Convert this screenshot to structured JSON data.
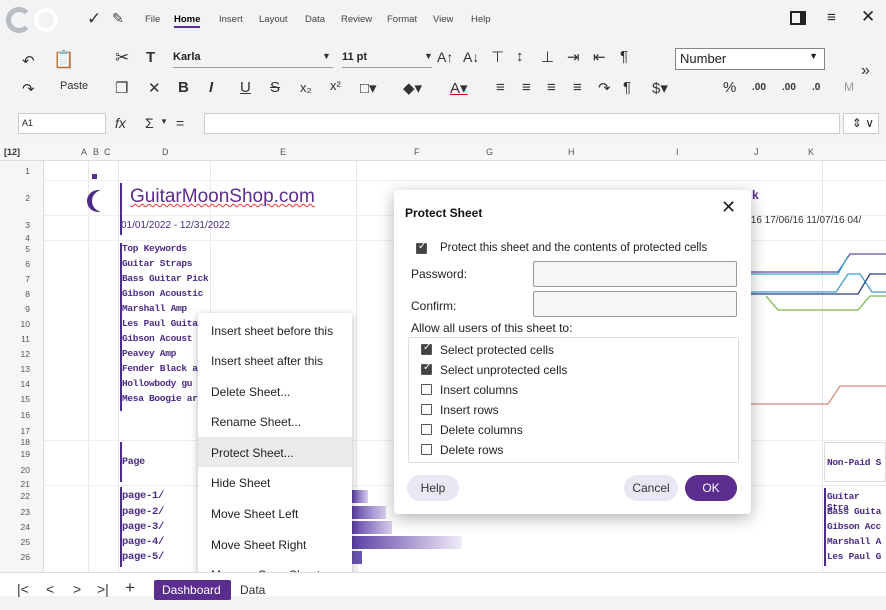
{
  "menubar": {
    "items": [
      "File",
      "Home",
      "Insert",
      "Layout",
      "Data",
      "Review",
      "Format",
      "View",
      "Help"
    ],
    "active": "Home"
  },
  "toolbar": {
    "paste_label": "Paste",
    "font_name": "Karla",
    "font_size": "11 pt",
    "number_format": "Number",
    "more": "»"
  },
  "formula": {
    "cell_ref": "A1",
    "fx": "fx",
    "sum": "Σ",
    "eq": "="
  },
  "columns": [
    "A",
    "B",
    "C",
    "D",
    "E",
    "F",
    "G",
    "H",
    "I",
    "J",
    "K"
  ],
  "rows": [
    "1",
    "2",
    "3",
    "4",
    "5",
    "6",
    "7",
    "8",
    "9",
    "10",
    "11",
    "12",
    "13",
    "14",
    "15",
    "16",
    "17",
    "18",
    "19",
    "20",
    "21",
    "22",
    "23",
    "24",
    "25",
    "26"
  ],
  "sheet": {
    "title": "GuitarMoonShop.com",
    "date_range": "01/01/2022 - 12/31/2022",
    "keywords_header": "Top Keywords",
    "keywords": [
      "Guitar Straps",
      "Bass Guitar Pick",
      "Gibson Acoustic",
      "Marshall Amp",
      "Les Paul Guitar",
      "Gibson Acoust",
      "Peavey Amp",
      "Fender Black ar",
      "Hollowbody gu",
      "Mesa Boogie ar"
    ],
    "page_header": "Page",
    "pages": [
      "page-1/",
      "page-2/",
      "page-3/",
      "page-4/",
      "page-5/"
    ],
    "nonpaid_header": "Non-Paid S",
    "nonpaid": [
      "Guitar Stra",
      "Bass Guita",
      "Gibson Acc",
      "Marshall A",
      "Les Paul G"
    ],
    "chart_k": "k",
    "chart_dates": "/16 17/06/16 11/07/16 04/"
  },
  "context_menu": {
    "items": [
      "Insert sheet before this",
      "Insert sheet after this",
      "Delete Sheet...",
      "Rename Sheet...",
      "Protect Sheet...",
      "Hide Sheet",
      "Move Sheet Left",
      "Move Sheet Right",
      "Move or Copy Sheet..."
    ],
    "selected": "Protect Sheet..."
  },
  "dialog": {
    "title": "Protect Sheet",
    "protect_label": "Protect this sheet and the contents of protected cells",
    "password_label": "Password:",
    "confirm_label": "Confirm:",
    "allow_label": "Allow all users of this sheet to:",
    "permissions": [
      {
        "label": "Select protected cells",
        "checked": true
      },
      {
        "label": "Select unprotected cells",
        "checked": true
      },
      {
        "label": "Insert columns",
        "checked": false
      },
      {
        "label": "Insert rows",
        "checked": false
      },
      {
        "label": "Delete columns",
        "checked": false
      },
      {
        "label": "Delete rows",
        "checked": false
      }
    ],
    "help": "Help",
    "cancel": "Cancel",
    "ok": "OK"
  },
  "tabs": {
    "sheets": [
      "Dashboard",
      "Data"
    ],
    "active": "Dashboard",
    "add": "+"
  },
  "colors": {
    "accent": "#5b2d8e",
    "keyword": "#4b2c86"
  }
}
